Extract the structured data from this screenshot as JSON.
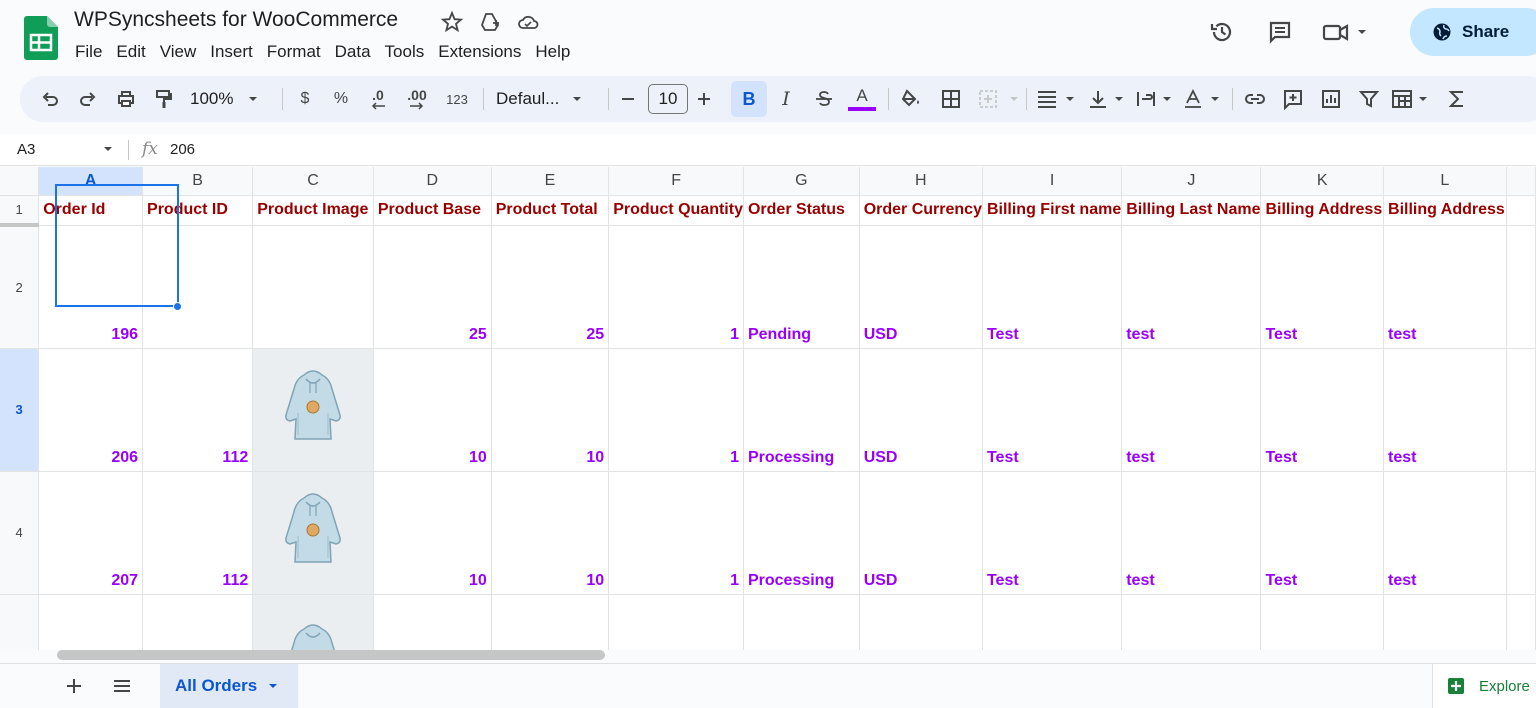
{
  "doc": {
    "title": "WPSyncsheets for WooCommerce"
  },
  "menu": [
    "File",
    "Edit",
    "View",
    "Insert",
    "Format",
    "Data",
    "Tools",
    "Extensions",
    "Help"
  ],
  "share": {
    "label": "Share"
  },
  "toolbar": {
    "zoom": "100%",
    "currency": "$",
    "percent": "%",
    "decrease_decimal": ".0",
    "increase_decimal": ".00",
    "number_format": "123",
    "font": "Defaul...",
    "font_size": "10",
    "bold": "B",
    "italic": "I",
    "text_color_letter": "A"
  },
  "formula_bar": {
    "cell_ref": "A3",
    "fx": "fx",
    "value": "206"
  },
  "columns": [
    "A",
    "B",
    "C",
    "D",
    "E",
    "F",
    "G",
    "H",
    "I",
    "J",
    "K",
    "L"
  ],
  "headers": [
    "Order Id",
    "Product ID",
    "Product Image",
    "Product Base",
    "Product Total",
    "Product Quantity",
    "Order Status",
    "Order Currency",
    "Billing First name",
    "Billing Last Name",
    "Billing Address",
    "Billing Address"
  ],
  "rows": [
    {
      "num": "1"
    },
    {
      "num": "2",
      "cells": [
        "196",
        "",
        "",
        "25",
        "25",
        "1",
        "Pending",
        "USD",
        "Test",
        "test",
        "Test",
        "test"
      ]
    },
    {
      "num": "3",
      "cells": [
        "206",
        "112",
        "",
        "10",
        "10",
        "1",
        "Processing",
        "USD",
        "Test",
        "test",
        "Test",
        "test"
      ]
    },
    {
      "num": "4",
      "cells": [
        "207",
        "112",
        "",
        "10",
        "10",
        "1",
        "Processing",
        "USD",
        "Test",
        "test",
        "Test",
        "test"
      ]
    }
  ],
  "sheet_tab": {
    "label": "All Orders"
  },
  "explore": {
    "label": "Explore"
  },
  "colors": {
    "header_text": "#990000",
    "data_text": "#9900ff",
    "selection": "#1a73e8",
    "share_bg": "#c2e7ff"
  }
}
